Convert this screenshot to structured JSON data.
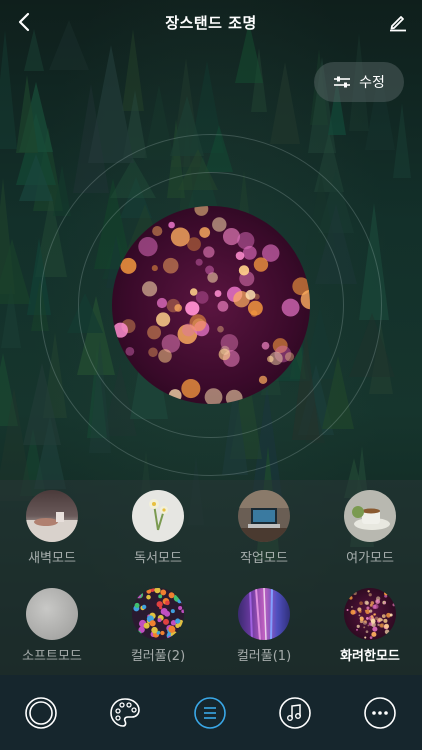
{
  "header": {
    "title": "장스탠드 조명",
    "back_icon": "chevron-left-icon",
    "edit_icon": "pencil-icon"
  },
  "adjust_button": {
    "label": "수정",
    "icon": "sliders-icon"
  },
  "light_preview": {
    "selected_mode": "화려한모드",
    "image": "fireworks"
  },
  "modes": [
    {
      "label": "새벽모드",
      "thumb": "dawn"
    },
    {
      "label": "독서모드",
      "thumb": "flower"
    },
    {
      "label": "작업모드",
      "thumb": "laptop"
    },
    {
      "label": "여가모드",
      "thumb": "tea"
    },
    {
      "label": "소프트모드",
      "thumb": "soft-gray"
    },
    {
      "label": "컬러풀(2)",
      "thumb": "colorful-beads"
    },
    {
      "label": "컬러풀(1)",
      "thumb": "colorful-lines"
    },
    {
      "label": "화려한모드",
      "thumb": "fireworks",
      "active": true
    }
  ],
  "bottom_nav": [
    {
      "icon": "ring-icon",
      "active": false
    },
    {
      "icon": "palette-icon",
      "active": false
    },
    {
      "icon": "list-icon",
      "active": true
    },
    {
      "icon": "music-icon",
      "active": false
    },
    {
      "icon": "more-icon",
      "active": false
    }
  ],
  "colors": {
    "accent": "#3aa8e8",
    "nav_bg": "#16262d",
    "panel_bg": "#2f3d3d"
  }
}
